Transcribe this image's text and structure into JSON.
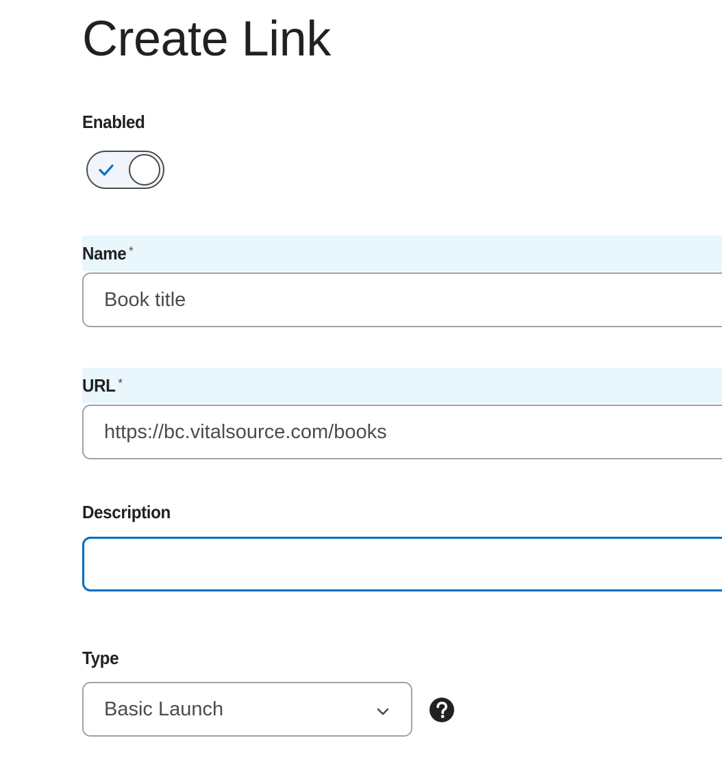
{
  "page": {
    "title": "Create Link"
  },
  "fields": {
    "enabled": {
      "label": "Enabled",
      "toggle_state": "on",
      "icon": "checkmark-icon"
    },
    "name": {
      "label": "Name",
      "required_marker": "*",
      "value": "Book title"
    },
    "url": {
      "label": "URL",
      "required_marker": "*",
      "value": "https://bc.vitalsource.com/books"
    },
    "description": {
      "label": "Description",
      "value": ""
    },
    "type": {
      "label": "Type",
      "selected": "Basic Launch",
      "chevron_icon": "chevron-down-icon",
      "help_icon": "help-icon"
    }
  },
  "colors": {
    "highlight_background": "#e9f7fd",
    "focus_border": "#006fbf",
    "checkmark": "#006fbf",
    "text": "#202122",
    "muted_text": "#494c4e"
  }
}
